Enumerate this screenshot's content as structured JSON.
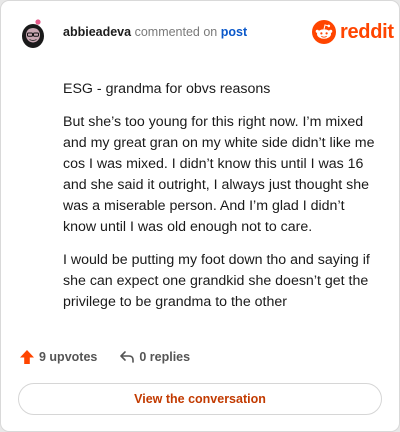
{
  "header": {
    "username": "abbieadeva",
    "action_text": "commented on",
    "post_link": "post"
  },
  "brand": {
    "logo_text": "reddit",
    "accent_color": "#ff4500",
    "logo_icon": "reddit-snoo-icon"
  },
  "comment": {
    "paragraphs": [
      "ESG - grandma for obvs reasons",
      "But she’s too young for this right now. I’m mixed and my great gran on my white side didn’t like me cos I was mixed. I didn’t know this until I was 16 and she said it outright, I always just thought she was a miserable person. And I’m glad I didn’t know until I was old enough not to care.",
      "I would be putting my foot down tho and saying if she can expect one grandkid she doesn’t get the privilege to be grandma to the other"
    ]
  },
  "actions": {
    "upvotes_label": "9 upvotes",
    "upvote_icon": "upvote-arrow-icon",
    "replies_label": "0 replies",
    "reply_icon": "reply-arrow-icon",
    "view_conversation_label": "View the conversation",
    "link_color": "#c23a00"
  }
}
